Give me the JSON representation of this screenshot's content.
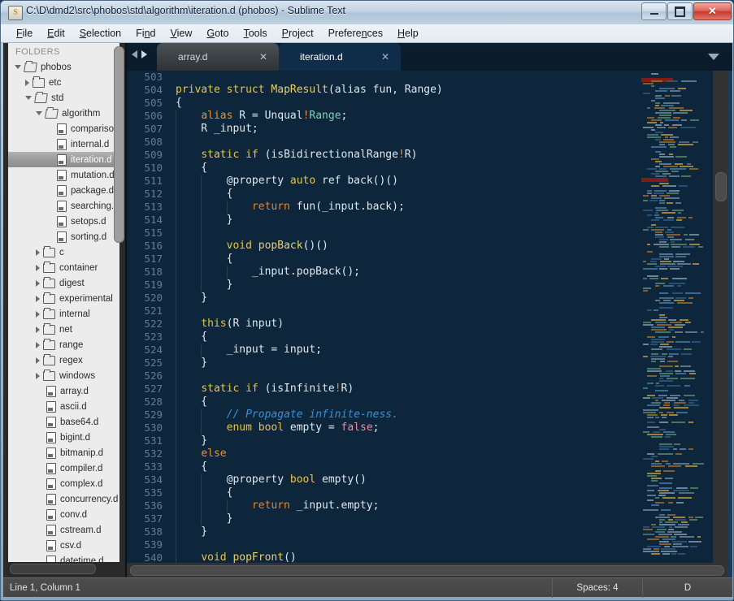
{
  "window": {
    "title": "C:\\D\\dmd2\\src\\phobos\\std\\algorithm\\iteration.d (phobos) - Sublime Text",
    "app_icon": "sublime-text-icon",
    "minimize_label": "Minimize",
    "maximize_label": "Maximize",
    "close_label": "Close",
    "close_glyph": "✕"
  },
  "menubar": {
    "items": [
      {
        "label": "File",
        "accel": "F"
      },
      {
        "label": "Edit",
        "accel": "E"
      },
      {
        "label": "Selection",
        "accel": "S"
      },
      {
        "label": "Find",
        "accel": "n"
      },
      {
        "label": "View",
        "accel": "V"
      },
      {
        "label": "Goto",
        "accel": "G"
      },
      {
        "label": "Tools",
        "accel": "T"
      },
      {
        "label": "Project",
        "accel": "P"
      },
      {
        "label": "Preferences",
        "accel": "n"
      },
      {
        "label": "Help",
        "accel": "H"
      }
    ]
  },
  "sidebar": {
    "header": "FOLDERS",
    "tree": [
      {
        "label": "phobos",
        "depth": 0,
        "kind": "folder",
        "state": "open",
        "selected": false
      },
      {
        "label": "etc",
        "depth": 1,
        "kind": "folder",
        "state": "closed",
        "selected": false
      },
      {
        "label": "std",
        "depth": 1,
        "kind": "folder",
        "state": "open",
        "selected": false
      },
      {
        "label": "algorithm",
        "depth": 2,
        "kind": "folder",
        "state": "open",
        "selected": false
      },
      {
        "label": "comparison.d",
        "depth": 3,
        "kind": "file",
        "state": "none",
        "selected": false
      },
      {
        "label": "internal.d",
        "depth": 3,
        "kind": "file",
        "state": "none",
        "selected": false
      },
      {
        "label": "iteration.d",
        "depth": 3,
        "kind": "file",
        "state": "none",
        "selected": true
      },
      {
        "label": "mutation.d",
        "depth": 3,
        "kind": "file",
        "state": "none",
        "selected": false
      },
      {
        "label": "package.d",
        "depth": 3,
        "kind": "file",
        "state": "none",
        "selected": false
      },
      {
        "label": "searching.d",
        "depth": 3,
        "kind": "file",
        "state": "none",
        "selected": false
      },
      {
        "label": "setops.d",
        "depth": 3,
        "kind": "file",
        "state": "none",
        "selected": false
      },
      {
        "label": "sorting.d",
        "depth": 3,
        "kind": "file",
        "state": "none",
        "selected": false
      },
      {
        "label": "c",
        "depth": 2,
        "kind": "folder",
        "state": "closed",
        "selected": false
      },
      {
        "label": "container",
        "depth": 2,
        "kind": "folder",
        "state": "closed",
        "selected": false
      },
      {
        "label": "digest",
        "depth": 2,
        "kind": "folder",
        "state": "closed",
        "selected": false
      },
      {
        "label": "experimental",
        "depth": 2,
        "kind": "folder",
        "state": "closed",
        "selected": false
      },
      {
        "label": "internal",
        "depth": 2,
        "kind": "folder",
        "state": "closed",
        "selected": false
      },
      {
        "label": "net",
        "depth": 2,
        "kind": "folder",
        "state": "closed",
        "selected": false
      },
      {
        "label": "range",
        "depth": 2,
        "kind": "folder",
        "state": "closed",
        "selected": false
      },
      {
        "label": "regex",
        "depth": 2,
        "kind": "folder",
        "state": "closed",
        "selected": false
      },
      {
        "label": "windows",
        "depth": 2,
        "kind": "folder",
        "state": "closed",
        "selected": false
      },
      {
        "label": "array.d",
        "depth": 2,
        "kind": "file",
        "state": "none",
        "selected": false
      },
      {
        "label": "ascii.d",
        "depth": 2,
        "kind": "file",
        "state": "none",
        "selected": false
      },
      {
        "label": "base64.d",
        "depth": 2,
        "kind": "file",
        "state": "none",
        "selected": false
      },
      {
        "label": "bigint.d",
        "depth": 2,
        "kind": "file",
        "state": "none",
        "selected": false
      },
      {
        "label": "bitmanip.d",
        "depth": 2,
        "kind": "file",
        "state": "none",
        "selected": false
      },
      {
        "label": "compiler.d",
        "depth": 2,
        "kind": "file",
        "state": "none",
        "selected": false
      },
      {
        "label": "complex.d",
        "depth": 2,
        "kind": "file",
        "state": "none",
        "selected": false
      },
      {
        "label": "concurrency.d",
        "depth": 2,
        "kind": "file",
        "state": "none",
        "selected": false
      },
      {
        "label": "conv.d",
        "depth": 2,
        "kind": "file",
        "state": "none",
        "selected": false
      },
      {
        "label": "cstream.d",
        "depth": 2,
        "kind": "file",
        "state": "none",
        "selected": false
      },
      {
        "label": "csv.d",
        "depth": 2,
        "kind": "file",
        "state": "none",
        "selected": false
      },
      {
        "label": "datetime.d",
        "depth": 2,
        "kind": "file",
        "state": "none",
        "selected": false
      }
    ]
  },
  "tabs": {
    "nav_prev": "◀",
    "nav_next": "▶",
    "close_glyph": "✕",
    "items": [
      {
        "label": "array.d",
        "active": false
      },
      {
        "label": "iteration.d",
        "active": true
      }
    ]
  },
  "editor": {
    "first_line": 503,
    "lines": [
      {
        "n": 503,
        "indent": 0,
        "tokens": []
      },
      {
        "n": 504,
        "indent": 0,
        "tokens": [
          {
            "t": "private",
            "c": "k-kw"
          },
          {
            "t": " ",
            "c": "k-def"
          },
          {
            "t": "struct",
            "c": "k-kw"
          },
          {
            "t": " ",
            "c": "k-def"
          },
          {
            "t": "MapResult",
            "c": "k-fn"
          },
          {
            "t": "(alias fun, Range)",
            "c": "k-def"
          }
        ]
      },
      {
        "n": 505,
        "indent": 0,
        "tokens": [
          {
            "t": "{",
            "c": "k-def"
          }
        ]
      },
      {
        "n": 506,
        "indent": 1,
        "tokens": [
          {
            "t": "    ",
            "c": "k-def"
          },
          {
            "t": "alias",
            "c": "k-org"
          },
          {
            "t": " R = ",
            "c": "k-def"
          },
          {
            "t": "Unqual",
            "c": "k-def"
          },
          {
            "t": "!",
            "c": "k-op"
          },
          {
            "t": "Range",
            "c": "k-cls"
          },
          {
            "t": ";",
            "c": "k-def"
          }
        ]
      },
      {
        "n": 507,
        "indent": 1,
        "tokens": [
          {
            "t": "    R _input;",
            "c": "k-def"
          }
        ]
      },
      {
        "n": 508,
        "indent": 1,
        "tokens": []
      },
      {
        "n": 509,
        "indent": 1,
        "tokens": [
          {
            "t": "    ",
            "c": "k-def"
          },
          {
            "t": "static",
            "c": "k-kw"
          },
          {
            "t": " ",
            "c": "k-def"
          },
          {
            "t": "if",
            "c": "k-kw"
          },
          {
            "t": " (isBidirectionalRange",
            "c": "k-def"
          },
          {
            "t": "!",
            "c": "k-op"
          },
          {
            "t": "R)",
            "c": "k-def"
          }
        ]
      },
      {
        "n": 510,
        "indent": 1,
        "tokens": [
          {
            "t": "    {",
            "c": "k-def"
          }
        ]
      },
      {
        "n": 511,
        "indent": 2,
        "tokens": [
          {
            "t": "        @property ",
            "c": "k-def"
          },
          {
            "t": "auto",
            "c": "k-kw"
          },
          {
            "t": " ref back()()",
            "c": "k-def"
          }
        ]
      },
      {
        "n": 512,
        "indent": 2,
        "tokens": [
          {
            "t": "        {",
            "c": "k-def"
          }
        ]
      },
      {
        "n": 513,
        "indent": 3,
        "tokens": [
          {
            "t": "            ",
            "c": "k-def"
          },
          {
            "t": "return",
            "c": "k-ctl"
          },
          {
            "t": " fun(_input.back);",
            "c": "k-def"
          }
        ]
      },
      {
        "n": 514,
        "indent": 2,
        "tokens": [
          {
            "t": "        }",
            "c": "k-def"
          }
        ]
      },
      {
        "n": 515,
        "indent": 2,
        "tokens": []
      },
      {
        "n": 516,
        "indent": 2,
        "tokens": [
          {
            "t": "        ",
            "c": "k-def"
          },
          {
            "t": "void",
            "c": "k-kw"
          },
          {
            "t": " ",
            "c": "k-def"
          },
          {
            "t": "popBack",
            "c": "k-fn"
          },
          {
            "t": "()()",
            "c": "k-def"
          }
        ]
      },
      {
        "n": 517,
        "indent": 2,
        "tokens": [
          {
            "t": "        {",
            "c": "k-def"
          }
        ]
      },
      {
        "n": 518,
        "indent": 3,
        "tokens": [
          {
            "t": "            _input.popBack();",
            "c": "k-def"
          }
        ]
      },
      {
        "n": 519,
        "indent": 2,
        "tokens": [
          {
            "t": "        }",
            "c": "k-def"
          }
        ]
      },
      {
        "n": 520,
        "indent": 1,
        "tokens": [
          {
            "t": "    }",
            "c": "k-def"
          }
        ]
      },
      {
        "n": 521,
        "indent": 1,
        "tokens": []
      },
      {
        "n": 522,
        "indent": 1,
        "tokens": [
          {
            "t": "    ",
            "c": "k-def"
          },
          {
            "t": "this",
            "c": "k-kw"
          },
          {
            "t": "(R input)",
            "c": "k-def"
          }
        ]
      },
      {
        "n": 523,
        "indent": 1,
        "tokens": [
          {
            "t": "    {",
            "c": "k-def"
          }
        ]
      },
      {
        "n": 524,
        "indent": 2,
        "tokens": [
          {
            "t": "        _input = input;",
            "c": "k-def"
          }
        ]
      },
      {
        "n": 525,
        "indent": 1,
        "tokens": [
          {
            "t": "    }",
            "c": "k-def"
          }
        ]
      },
      {
        "n": 526,
        "indent": 1,
        "tokens": []
      },
      {
        "n": 527,
        "indent": 1,
        "tokens": [
          {
            "t": "    ",
            "c": "k-def"
          },
          {
            "t": "static",
            "c": "k-kw"
          },
          {
            "t": " ",
            "c": "k-def"
          },
          {
            "t": "if",
            "c": "k-kw"
          },
          {
            "t": " (isInfinite",
            "c": "k-def"
          },
          {
            "t": "!",
            "c": "k-op"
          },
          {
            "t": "R)",
            "c": "k-def"
          }
        ]
      },
      {
        "n": 528,
        "indent": 1,
        "tokens": [
          {
            "t": "    {",
            "c": "k-def"
          }
        ]
      },
      {
        "n": 529,
        "indent": 2,
        "tokens": [
          {
            "t": "        ",
            "c": "k-def"
          },
          {
            "t": "// Propagate infinite-ness.",
            "c": "k-cmt"
          }
        ]
      },
      {
        "n": 530,
        "indent": 2,
        "tokens": [
          {
            "t": "        ",
            "c": "k-def"
          },
          {
            "t": "enum",
            "c": "k-kw"
          },
          {
            "t": " ",
            "c": "k-def"
          },
          {
            "t": "bool",
            "c": "k-kw"
          },
          {
            "t": " empty = ",
            "c": "k-def"
          },
          {
            "t": "false",
            "c": "k-num"
          },
          {
            "t": ";",
            "c": "k-def"
          }
        ]
      },
      {
        "n": 531,
        "indent": 1,
        "tokens": [
          {
            "t": "    }",
            "c": "k-def"
          }
        ]
      },
      {
        "n": 532,
        "indent": 1,
        "tokens": [
          {
            "t": "    ",
            "c": "k-def"
          },
          {
            "t": "else",
            "c": "k-org"
          }
        ]
      },
      {
        "n": 533,
        "indent": 1,
        "tokens": [
          {
            "t": "    {",
            "c": "k-def"
          }
        ]
      },
      {
        "n": 534,
        "indent": 2,
        "tokens": [
          {
            "t": "        @property ",
            "c": "k-def"
          },
          {
            "t": "bool",
            "c": "k-kw"
          },
          {
            "t": " empty()",
            "c": "k-def"
          }
        ]
      },
      {
        "n": 535,
        "indent": 2,
        "tokens": [
          {
            "t": "        {",
            "c": "k-def"
          }
        ]
      },
      {
        "n": 536,
        "indent": 3,
        "tokens": [
          {
            "t": "            ",
            "c": "k-def"
          },
          {
            "t": "return",
            "c": "k-ctl"
          },
          {
            "t": " _input.empty;",
            "c": "k-def"
          }
        ]
      },
      {
        "n": 537,
        "indent": 2,
        "tokens": [
          {
            "t": "        }",
            "c": "k-def"
          }
        ]
      },
      {
        "n": 538,
        "indent": 1,
        "tokens": [
          {
            "t": "    }",
            "c": "k-def"
          }
        ]
      },
      {
        "n": 539,
        "indent": 1,
        "tokens": []
      },
      {
        "n": 540,
        "indent": 1,
        "tokens": [
          {
            "t": "    ",
            "c": "k-def"
          },
          {
            "t": "void",
            "c": "k-kw"
          },
          {
            "t": " ",
            "c": "k-def"
          },
          {
            "t": "popFront",
            "c": "k-fn"
          },
          {
            "t": "()",
            "c": "k-def"
          }
        ]
      }
    ]
  },
  "statusbar": {
    "caret": "Line 1, Column 1",
    "indent": "Spaces: 4",
    "syntax": "D"
  },
  "colors": {
    "editor_bg": "#0d263c",
    "tab_active_bg": "#0f2d48",
    "keyword": "#e8c547",
    "comment": "#3e8fd0",
    "string": "#9ecb74",
    "operator": "#e8923c",
    "number": "#e48fa3",
    "class": "#7fd0b2",
    "linenumber": "#5f7d96",
    "minimap_highlight": "#8b1c14"
  }
}
